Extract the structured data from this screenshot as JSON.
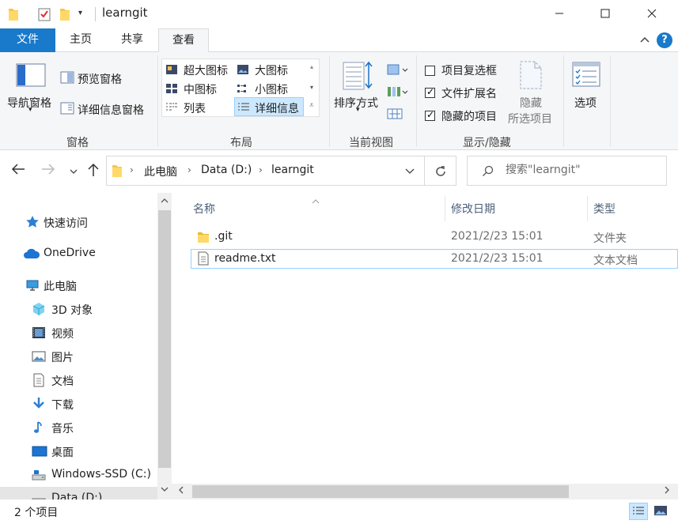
{
  "window": {
    "title": "learngit"
  },
  "ribbon_tabs": [
    {
      "label": "文件"
    },
    {
      "label": "主页"
    },
    {
      "label": "共享"
    },
    {
      "label": "查看"
    }
  ],
  "ribbon": {
    "panes": {
      "nav_pane": "导航窗格",
      "preview_pane": "预览窗格",
      "details_pane": "详细信息窗格",
      "group_label": "窗格"
    },
    "layout": {
      "extra_large": "超大图标",
      "large": "大图标",
      "medium": "中图标",
      "small": "小图标",
      "list": "列表",
      "details": "详细信息",
      "group_label": "布局"
    },
    "current_view": {
      "sort_by": "排序方式",
      "group_label": "当前视图"
    },
    "show_hide": {
      "item_checkboxes": "项目复选框",
      "file_extensions": "文件扩展名",
      "hidden_items": "隐藏的项目",
      "item_checkboxes_checked": false,
      "file_extensions_checked": true,
      "hidden_items_checked": true,
      "hide_selected_line1": "隐藏",
      "hide_selected_line2": "所选项目",
      "group_label": "显示/隐藏"
    },
    "options": {
      "label": "选项"
    }
  },
  "address": {
    "breadcrumb": [
      "此电脑",
      "Data (D:)",
      "learngit"
    ],
    "search_placeholder": "搜索\"learngit\""
  },
  "nav_pane": {
    "items": [
      {
        "label": "快速访问",
        "icon": "star-icon"
      },
      {
        "label": "OneDrive",
        "icon": "cloud-icon"
      },
      {
        "label": "此电脑",
        "icon": "computer-icon"
      },
      {
        "label": "3D 对象",
        "icon": "cube-icon"
      },
      {
        "label": "视频",
        "icon": "video-icon"
      },
      {
        "label": "图片",
        "icon": "picture-icon"
      },
      {
        "label": "文档",
        "icon": "document-icon"
      },
      {
        "label": "下载",
        "icon": "download-icon"
      },
      {
        "label": "音乐",
        "icon": "music-icon"
      },
      {
        "label": "桌面",
        "icon": "desktop-icon"
      },
      {
        "label": "Windows-SSD (C:)",
        "icon": "drive-icon"
      },
      {
        "label": "Data (D:)",
        "icon": "drive-icon"
      }
    ]
  },
  "file_list": {
    "columns": [
      "名称",
      "修改日期",
      "类型"
    ],
    "rows": [
      {
        "name": ".git",
        "modified": "2021/2/23 15:01",
        "type": "文件夹",
        "icon": "folder-icon"
      },
      {
        "name": "readme.txt",
        "modified": "2021/2/23 15:01",
        "type": "文本文档",
        "icon": "text-file-icon"
      }
    ]
  },
  "status": {
    "item_count": "2 个项目"
  },
  "colors": {
    "accent": "#1979ca",
    "selection": "#cce8ff",
    "selection_border": "#99d1ff",
    "ribbon_bg": "#f5f6f7"
  }
}
